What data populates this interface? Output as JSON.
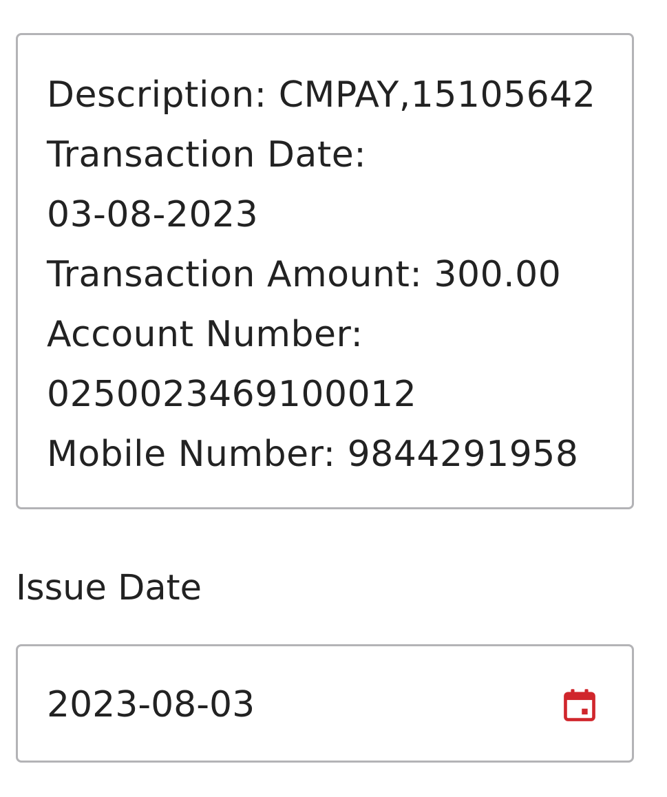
{
  "transaction_details": {
    "lines": [
      "Description: CMPAY,15105642",
      "Transaction Date:",
      "03-08-2023",
      "Transaction Amount: 300.00",
      "Account Number:",
      "0250023469100012",
      "Mobile Number: 9844291958"
    ]
  },
  "issue_date": {
    "label": "Issue Date",
    "value": "2023-08-03",
    "icon": "calendar-icon"
  },
  "colors": {
    "text": "#222222",
    "border": "#b3b3b6",
    "accent": "#d0262c"
  }
}
